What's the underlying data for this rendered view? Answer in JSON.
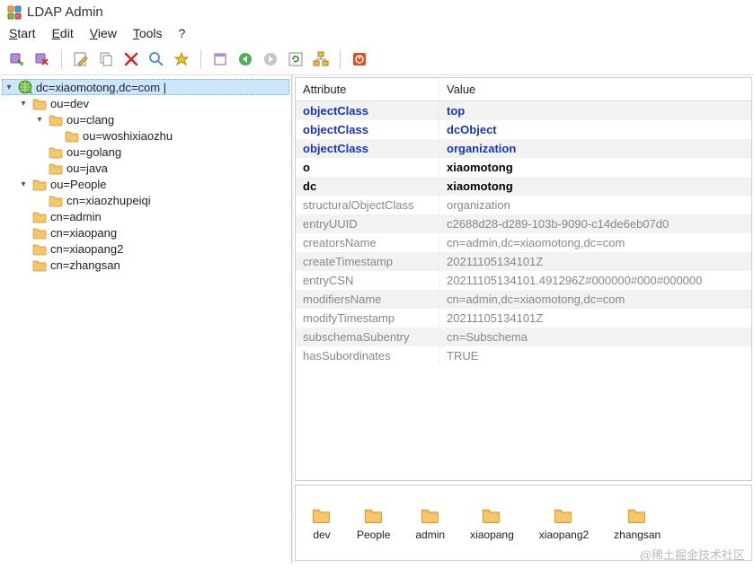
{
  "window": {
    "title": "LDAP Admin"
  },
  "menu": {
    "start": "Start",
    "edit": "Edit",
    "view": "View",
    "tools": "Tools",
    "help": "?"
  },
  "tree": {
    "root": "dc=xiaomotong,dc=com |",
    "dev": "ou=dev",
    "clang": "ou=clang",
    "woshixiaozhu": "ou=woshixiaozhu",
    "golang": "ou=golang",
    "java": "ou=java",
    "people": "ou=People",
    "xiaozhupeiqi": "cn=xiaozhupeiqi",
    "admin": "cn=admin",
    "xiaopang": "cn=xiaopang",
    "xiaopang2": "cn=xiaopang2",
    "zhangsan": "cn=zhangsan"
  },
  "attr_headers": {
    "attribute": "Attribute",
    "value": "Value"
  },
  "attributes": [
    {
      "a": "objectClass",
      "v": "top",
      "style": "bold-blue"
    },
    {
      "a": "objectClass",
      "v": "dcObject",
      "style": "bold-blue"
    },
    {
      "a": "objectClass",
      "v": "organization",
      "style": "bold-blue"
    },
    {
      "a": "o",
      "v": "xiaomotong",
      "style": "bold-black"
    },
    {
      "a": "dc",
      "v": "xiaomotong",
      "style": "bold-black"
    },
    {
      "a": "structuralObjectClass",
      "v": "organization",
      "style": "gray"
    },
    {
      "a": "entryUUID",
      "v": "c2688d28-d289-103b-9090-c14de6eb07d0",
      "style": "gray"
    },
    {
      "a": "creatorsName",
      "v": "cn=admin,dc=xiaomotong,dc=com",
      "style": "gray"
    },
    {
      "a": "createTimestamp",
      "v": "20211105134101Z",
      "style": "gray"
    },
    {
      "a": "entryCSN",
      "v": "20211105134101.491296Z#000000#000#000000",
      "style": "gray"
    },
    {
      "a": "modifiersName",
      "v": "cn=admin,dc=xiaomotong,dc=com",
      "style": "gray"
    },
    {
      "a": "modifyTimestamp",
      "v": "20211105134101Z",
      "style": "gray"
    },
    {
      "a": "subschemaSubentry",
      "v": "cn=Subschema",
      "style": "gray"
    },
    {
      "a": "hasSubordinates",
      "v": "TRUE",
      "style": "gray"
    }
  ],
  "thumbs": [
    "dev",
    "People",
    "admin",
    "xiaopang",
    "xiaopang2",
    "zhangsan"
  ],
  "watermark": "@稀土掘金技术社区"
}
